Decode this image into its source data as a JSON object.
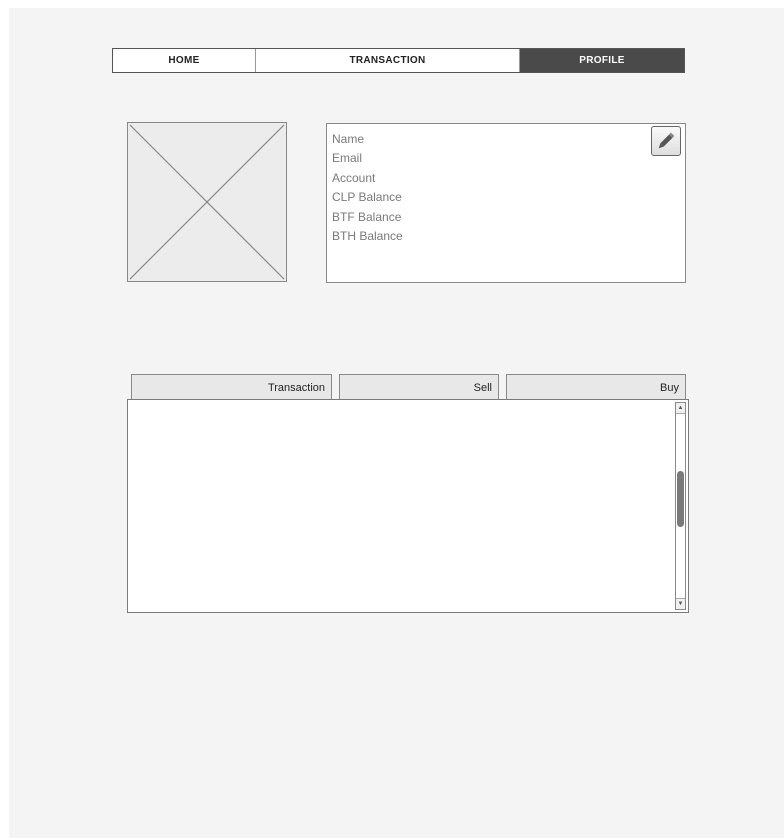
{
  "nav": {
    "home": "HOME",
    "transaction": "TRANSACTION",
    "profile": "PROFILE",
    "active_color": "#4a4a4a"
  },
  "avatar": {
    "icon": "image-placeholder-icon"
  },
  "profile_info": {
    "fields": [
      "Name",
      "Email",
      "Account",
      "CLP Balance",
      "BTF Balance",
      "BTH Balance"
    ],
    "edit_icon": "pencil-icon"
  },
  "tabs": {
    "transaction": "Transaction",
    "sell": "Sell",
    "buy": "Buy"
  },
  "scrollbar": {
    "up_icon": "▲",
    "down_icon": "▼"
  }
}
